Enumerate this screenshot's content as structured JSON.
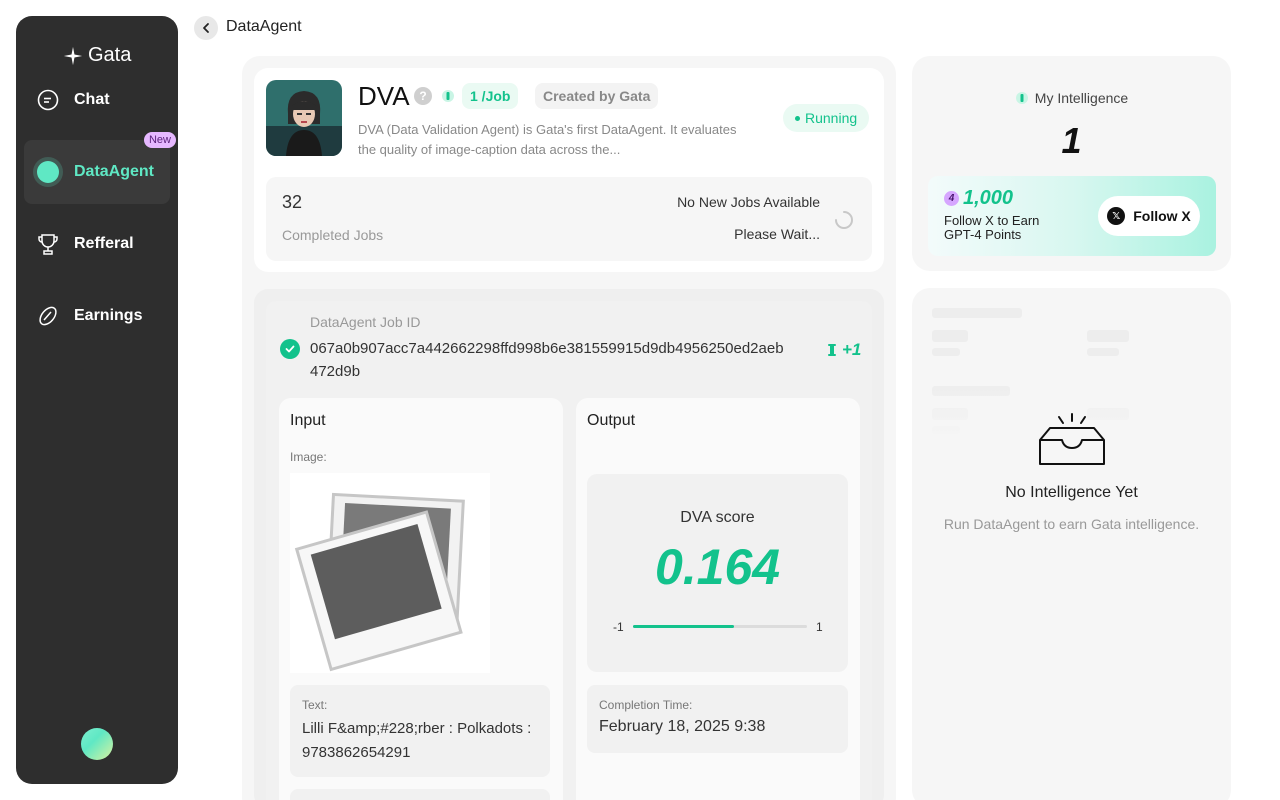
{
  "app": {
    "logo_text": "Gata"
  },
  "sidebar": {
    "items": [
      {
        "label": "Chat",
        "icon": "chat-bubble-icon"
      },
      {
        "label": "DataAgent",
        "icon": "status-dot-icon",
        "badge": "New",
        "active": true
      },
      {
        "label": "Refferal",
        "icon": "trophy-icon"
      },
      {
        "label": "Earnings",
        "icon": "coin-icon"
      }
    ]
  },
  "header": {
    "title": "DataAgent"
  },
  "agent": {
    "name": "DVA",
    "help": "?",
    "price": "1 /Job",
    "creator": "Created by Gata",
    "status": "Running",
    "description": "DVA (Data Validation Agent) is Gata's first DataAgent. It evaluates the quality of image-caption data across the...",
    "completed_jobs": "32",
    "completed_jobs_label": "Completed Jobs",
    "job_status": "No New Jobs Available",
    "job_status_sub": "Please Wait..."
  },
  "job": {
    "id_label": "DataAgent Job ID",
    "id_value": "067a0b907acc7a442662298ffd998b6e381559915d9db4956250ed2aeb472d9b",
    "reward": "+1",
    "input": {
      "title": "Input",
      "image_label": "Image:",
      "text_label": "Text:",
      "text_value": "Lilli F&amp;#228;rber : Polkadots : 9783862654291"
    },
    "output": {
      "title": "Output",
      "score_label": "DVA score",
      "score_value": "0.164",
      "score_min": "-1",
      "score_max": "1",
      "score_fraction": 0.582,
      "completion_label": "Completion Time:",
      "completion_value": "February 18, 2025 9:38"
    }
  },
  "intelligence": {
    "label": "My Intelligence",
    "value": "1",
    "follow": {
      "points": "1,000",
      "coin_glyph": "4",
      "text_line1": "Follow X to Earn",
      "text_line2": "GPT-4 Points",
      "button_label": "Follow X"
    },
    "empty_title": "No Intelligence Yet",
    "empty_sub": "Run DataAgent to earn Gata intelligence."
  },
  "colors": {
    "accent": "#13c28c",
    "sidebar_bg": "#2e2e2e",
    "active_nav": "#5fe8c4"
  }
}
